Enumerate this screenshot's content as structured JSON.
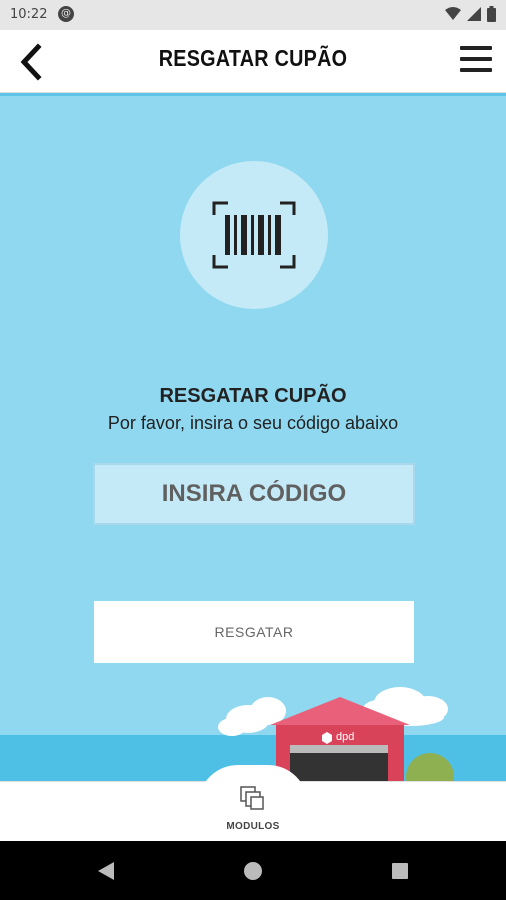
{
  "status_bar": {
    "time": "10:22"
  },
  "app_bar": {
    "title": "RESGATAR CUPÃO",
    "back_icon": "chevron-left-icon",
    "menu_icon": "hamburger-menu-icon"
  },
  "coupon": {
    "icon": "barcode-scan-icon",
    "heading": "RESGATAR CUPÃO",
    "subheading": "Por favor, insira o seu código abaixo",
    "input_placeholder": "INSIRA CÓDIGO",
    "input_value": "",
    "submit_label": "RESGATAR"
  },
  "scene": {
    "building_logo": "dpd"
  },
  "bottom_nav": {
    "modules_label": "MODULOS",
    "modules_icon": "layers-icon"
  },
  "colors": {
    "background": "#8fd8f0",
    "circle": "#c4eaf7",
    "building": "#d9435a",
    "roof": "#e86079"
  }
}
